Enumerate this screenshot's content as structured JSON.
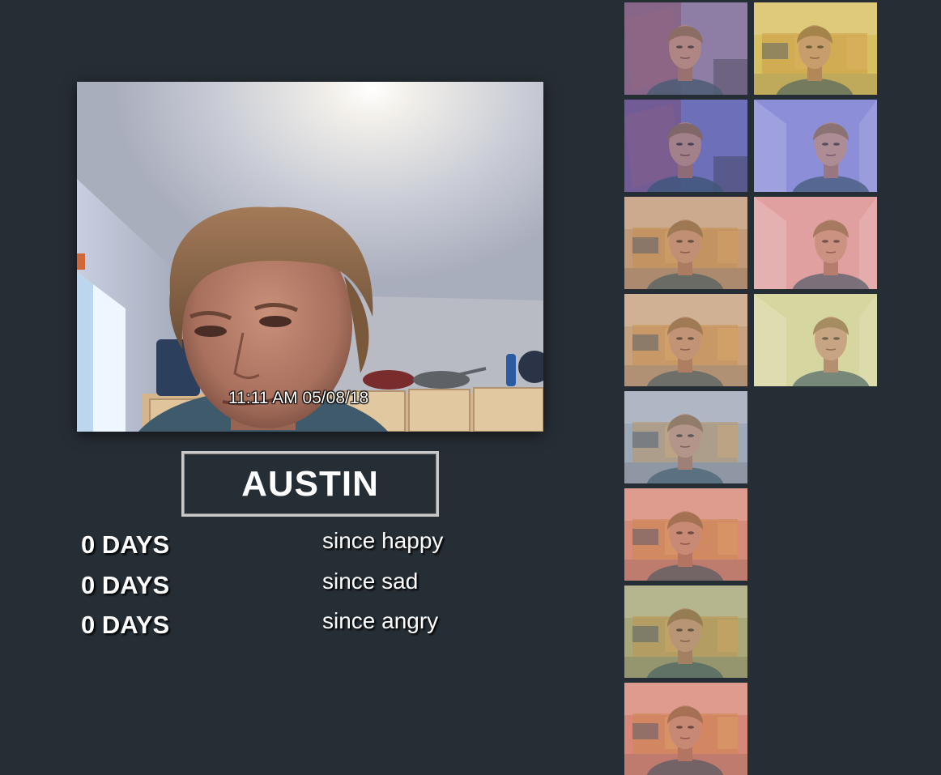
{
  "main_photo": {
    "timestamp": "11:11 AM 05/08/18"
  },
  "person": {
    "name": "AUSTIN"
  },
  "stats": [
    {
      "count": "0 DAYS",
      "label": "since happy"
    },
    {
      "count": "0 DAYS",
      "label": "since sad"
    },
    {
      "count": "0 DAYS",
      "label": "since angry"
    }
  ],
  "thumbnails": [
    {
      "tint": "#8e7fa6",
      "scene": "tapestry",
      "tint_name": "neutral"
    },
    {
      "tint": "#d8c060",
      "scene": "kitchen",
      "tint_name": "yellow"
    },
    {
      "tint": "#6e6fb8",
      "scene": "tapestry",
      "tint_name": "blue"
    },
    {
      "tint": "#8c8ed8",
      "scene": "room",
      "tint_name": "blue"
    },
    {
      "tint": "#c29a78",
      "scene": "kitchen",
      "tint_name": "warm"
    },
    {
      "tint": "#e0a0a0",
      "scene": "room",
      "tint_name": "pink"
    },
    {
      "tint": "#c8a27e",
      "scene": "kitchen",
      "tint_name": "warm"
    },
    {
      "tint": "#d6d6a0",
      "scene": "room",
      "tint_name": "yellow-green"
    },
    {
      "tint": "#9faab8",
      "scene": "kitchen",
      "tint_name": "cool"
    },
    {
      "tint": "#d68a78",
      "scene": "kitchen",
      "tint_name": "red"
    },
    {
      "tint": "#a8a878",
      "scene": "kitchen",
      "tint_name": "olive"
    },
    {
      "tint": "#d88878",
      "scene": "kitchen",
      "tint_name": "red"
    }
  ]
}
